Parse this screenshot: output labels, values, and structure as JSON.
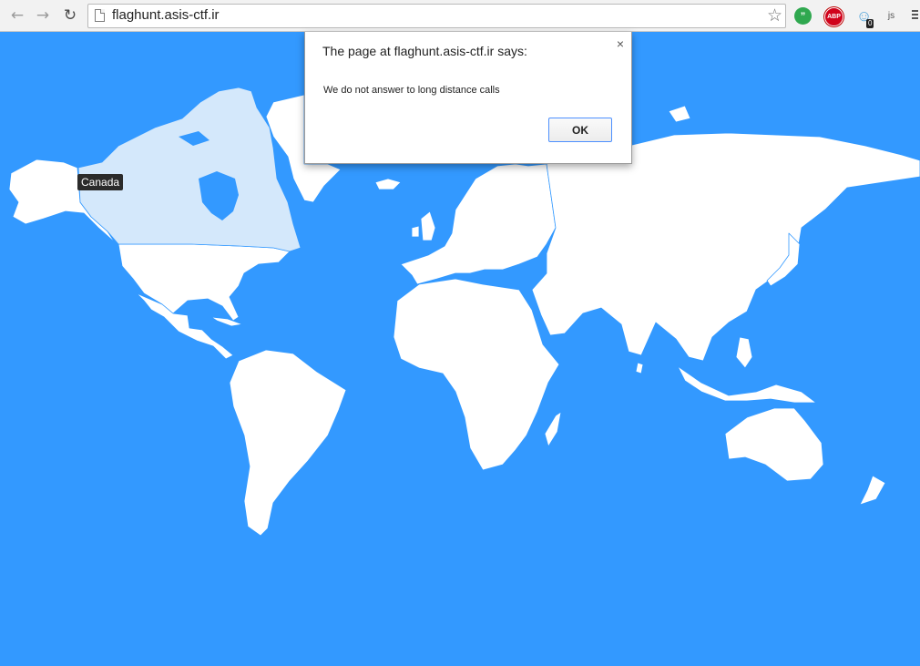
{
  "browser": {
    "url": "flaghunt.asis-ctf.ir",
    "extensions": [
      {
        "name": "hangouts-icon",
        "glyph": "”"
      },
      {
        "name": "adblock-plus-icon",
        "glyph": "ABP"
      },
      {
        "name": "ghostery-icon",
        "glyph": "☺",
        "badge": "0"
      },
      {
        "name": "js-toggle-icon",
        "glyph": "js"
      }
    ]
  },
  "map": {
    "ocean_color": "#3399ff",
    "land_color": "#ffffff",
    "border_color": "#3399ff",
    "highlight_color": "#d4e8fb",
    "highlighted_country": "Canada",
    "tooltip_text": "Canada"
  },
  "dialog": {
    "title": "The page at flaghunt.asis-ctf.ir says:",
    "message": "We do not answer to long distance calls",
    "ok_label": "OK",
    "close_glyph": "×"
  }
}
